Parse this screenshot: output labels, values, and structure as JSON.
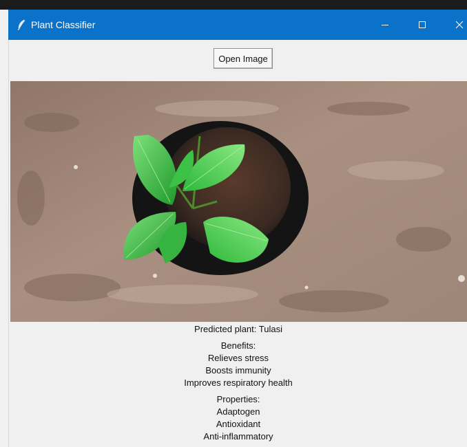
{
  "window": {
    "title": "Plant Classifier",
    "titlebar_color": "#0a72c9",
    "controls": [
      "minimize-icon",
      "maximize-icon",
      "close-icon"
    ]
  },
  "toolbar": {
    "open_label": "Open Image"
  },
  "image": {
    "subject": "plant-photo"
  },
  "result": {
    "predicted": "Predicted plant: Tulasi",
    "benefits_heading": "Benefits:",
    "benefits": [
      "Relieves stress",
      "Boosts immunity",
      "Improves respiratory health"
    ],
    "properties_heading": "Properties:",
    "properties": [
      "Adaptogen",
      "Antioxidant",
      "Anti-inflammatory"
    ]
  }
}
